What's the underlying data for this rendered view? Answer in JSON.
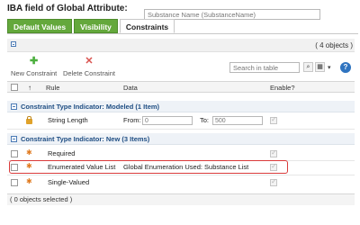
{
  "header": {
    "title": "IBA field of Global Attribute:",
    "input_placeholder": "Substance Name (SubstanceName)"
  },
  "tabs": [
    {
      "label": "Default Values"
    },
    {
      "label": "Visibility"
    },
    {
      "label": "Constraints"
    }
  ],
  "panel": {
    "object_count": "( 4 objects )"
  },
  "toolbar": {
    "new_label": "New Constraint",
    "delete_label": "Delete Constraint",
    "search_placeholder": "Search in table"
  },
  "table": {
    "columns": {
      "rule": "Rule",
      "data": "Data",
      "enable": "Enable?"
    },
    "groups": [
      {
        "label": "Constraint Type Indicator: Modeled (1 Item)",
        "rows": [
          {
            "rule": "String Length",
            "from_label": "From:",
            "from_value": "0",
            "to_label": "To:",
            "to_value": "500"
          }
        ]
      },
      {
        "label": "Constraint Type Indicator: New (3 Items)",
        "rows": [
          {
            "rule": "Required",
            "data": ""
          },
          {
            "rule": "Enumerated Value List",
            "data": "Global Enumeration Used: Substance List"
          },
          {
            "rule": "Single-Valued",
            "data": ""
          }
        ]
      }
    ]
  },
  "footer": {
    "selection": "( 0 objects selected )"
  },
  "colors": {
    "tab_green": "#64a83c",
    "group_text": "#1e4d83",
    "highlight": "#d93a3a",
    "new_icon": "#4caf3e",
    "delete_icon": "#d9534f"
  }
}
